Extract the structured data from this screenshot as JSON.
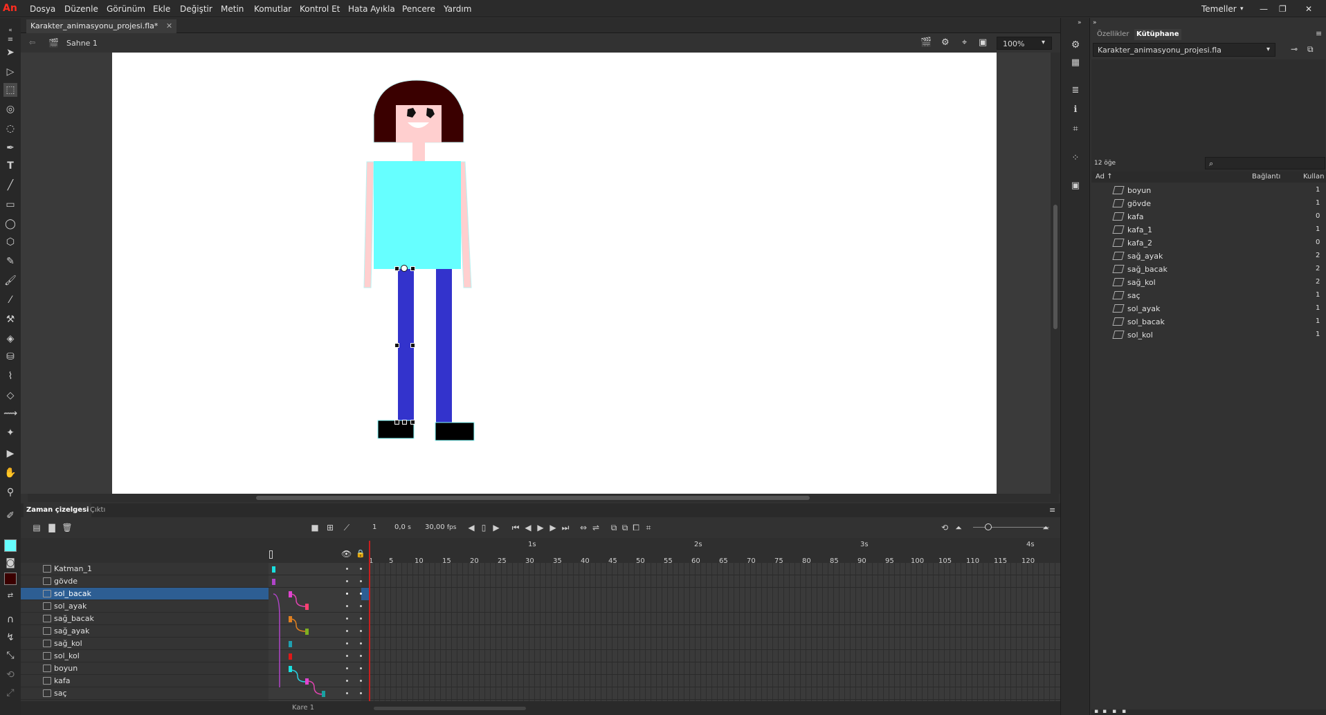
{
  "app": {
    "logo": "An",
    "workspace": "Temeller"
  },
  "menu": [
    "Dosya",
    "Düzenle",
    "Görünüm",
    "Ekle",
    "Değiştir",
    "Metin",
    "Komutlar",
    "Kontrol Et",
    "Hata Ayıkla",
    "Pencere",
    "Yardım"
  ],
  "document": {
    "tab": "Karakter_animasyonu_projesi.fla*",
    "scene": "Sahne 1",
    "zoom": "100%"
  },
  "stage_colors": {
    "hair": "#3a0000",
    "face": "#ffcfcf",
    "shirt": "#66ffff",
    "leg": "#3333cc",
    "shoe": "#000000",
    "arm": "#ffcfcf"
  },
  "timeline": {
    "tabs": [
      "Zaman çizelgesi",
      "Çıktı"
    ],
    "frame": "1",
    "time": "0,0",
    "time_unit": "s",
    "fps": "30,00",
    "fps_unit": "fps",
    "seconds": [
      "1s",
      "2s",
      "3s",
      "4s"
    ],
    "ticks": [
      "1",
      "5",
      "10",
      "15",
      "20",
      "25",
      "30",
      "35",
      "40",
      "45",
      "50",
      "55",
      "60",
      "65",
      "70",
      "75",
      "80",
      "85",
      "90",
      "95",
      "100",
      "105",
      "110",
      "115",
      "120"
    ],
    "current_frame_label": "Kare 1",
    "layers": [
      {
        "name": "Katman_1",
        "selected": false
      },
      {
        "name": "gövde",
        "selected": false
      },
      {
        "name": "sol_bacak",
        "selected": true
      },
      {
        "name": "sol_ayak",
        "selected": false
      },
      {
        "name": "sağ_bacak",
        "selected": false
      },
      {
        "name": "sağ_ayak",
        "selected": false
      },
      {
        "name": "sağ_kol",
        "selected": false
      },
      {
        "name": "sol_kol",
        "selected": false
      },
      {
        "name": "boyun",
        "selected": false
      },
      {
        "name": "kafa",
        "selected": false
      },
      {
        "name": "saç",
        "selected": false
      }
    ]
  },
  "library": {
    "tabs": [
      "Özellikler",
      "Kütüphane"
    ],
    "file": "Karakter_animasyonu_projesi.fla",
    "count": "12 öğe",
    "columns": [
      "Ad ↑",
      "Bağlantı",
      "Kullan"
    ],
    "items": [
      {
        "name": "boyun",
        "count": "1"
      },
      {
        "name": "gövde",
        "count": "1"
      },
      {
        "name": "kafa",
        "count": "0"
      },
      {
        "name": "kafa_1",
        "count": "1"
      },
      {
        "name": "kafa_2",
        "count": "0"
      },
      {
        "name": "sağ_ayak",
        "count": "2"
      },
      {
        "name": "sağ_bacak",
        "count": "2"
      },
      {
        "name": "sağ_kol",
        "count": "2"
      },
      {
        "name": "saç",
        "count": "1"
      },
      {
        "name": "sol_ayak",
        "count": "1"
      },
      {
        "name": "sol_bacak",
        "count": "1"
      },
      {
        "name": "sol_kol",
        "count": "1"
      }
    ]
  }
}
